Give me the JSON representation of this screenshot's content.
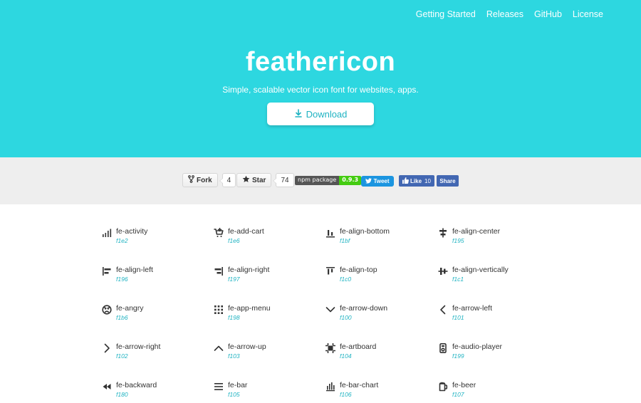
{
  "nav": {
    "links": [
      "Getting Started",
      "Releases",
      "GitHub",
      "License"
    ]
  },
  "hero": {
    "title": "feathericon",
    "subtitle": "Simple, scalable vector icon font for websites, apps.",
    "download_label": "Download"
  },
  "social": {
    "fork_label": "Fork",
    "fork_count": "4",
    "star_label": "Star",
    "star_count": "74",
    "npm_label": "npm package",
    "npm_version": "0.9.3",
    "tweet_label": "Tweet",
    "like_label": "Like",
    "like_count": "10",
    "share_label": "Share"
  },
  "icons": [
    {
      "name": "fe-activity",
      "code": "f1e2",
      "icon": "activity-icon"
    },
    {
      "name": "fe-add-cart",
      "code": "f1e6",
      "icon": "add-cart-icon"
    },
    {
      "name": "fe-align-bottom",
      "code": "f1bf",
      "icon": "align-bottom-icon"
    },
    {
      "name": "fe-align-center",
      "code": "f195",
      "icon": "align-center-icon"
    },
    {
      "name": "fe-align-left",
      "code": "f196",
      "icon": "align-left-icon"
    },
    {
      "name": "fe-align-right",
      "code": "f197",
      "icon": "align-right-icon"
    },
    {
      "name": "fe-align-top",
      "code": "f1c0",
      "icon": "align-top-icon"
    },
    {
      "name": "fe-align-vertically",
      "code": "f1c1",
      "icon": "align-vertically-icon"
    },
    {
      "name": "fe-angry",
      "code": "f1b6",
      "icon": "angry-icon"
    },
    {
      "name": "fe-app-menu",
      "code": "f198",
      "icon": "app-menu-icon"
    },
    {
      "name": "fe-arrow-down",
      "code": "f100",
      "icon": "arrow-down-icon"
    },
    {
      "name": "fe-arrow-left",
      "code": "f101",
      "icon": "arrow-left-icon"
    },
    {
      "name": "fe-arrow-right",
      "code": "f102",
      "icon": "arrow-right-icon"
    },
    {
      "name": "fe-arrow-up",
      "code": "f103",
      "icon": "arrow-up-icon"
    },
    {
      "name": "fe-artboard",
      "code": "f104",
      "icon": "artboard-icon"
    },
    {
      "name": "fe-audio-player",
      "code": "f199",
      "icon": "audio-player-icon"
    },
    {
      "name": "fe-backward",
      "code": "f180",
      "icon": "backward-icon"
    },
    {
      "name": "fe-bar",
      "code": "f105",
      "icon": "bar-icon"
    },
    {
      "name": "fe-bar-chart",
      "code": "f106",
      "icon": "bar-chart-icon"
    },
    {
      "name": "fe-beer",
      "code": "f107",
      "icon": "beer-icon"
    }
  ]
}
